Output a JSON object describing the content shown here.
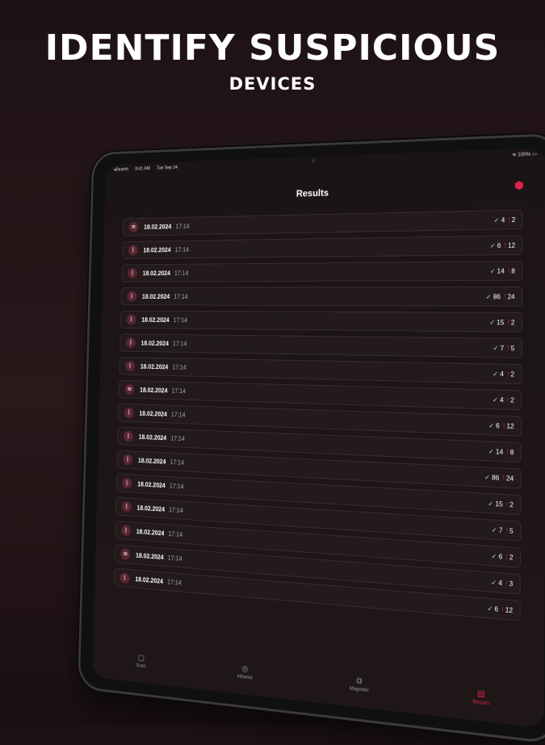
{
  "headline": "IDENTIFY SUSPICIOUS",
  "subheadline": "DEVICES",
  "status": {
    "back": "◂Search",
    "time": "9:41 AM",
    "date": "Tue Sep 24",
    "battery": "100%"
  },
  "screen_title": "Results",
  "accent": "#e0224a",
  "rows": [
    {
      "type": "wifi",
      "date": "18.02.2024",
      "time": "17:14",
      "ok": "4",
      "warn": "2"
    },
    {
      "type": "bluetooth",
      "date": "18.02.2024",
      "time": "17:14",
      "ok": "6",
      "warn": "12"
    },
    {
      "type": "bluetooth",
      "date": "18.02.2024",
      "time": "17:14",
      "ok": "14",
      "warn": "8"
    },
    {
      "type": "bluetooth",
      "date": "18.02.2024",
      "time": "17:14",
      "ok": "86",
      "warn": "24"
    },
    {
      "type": "bluetooth",
      "date": "18.02.2024",
      "time": "17:14",
      "ok": "15",
      "warn": "2"
    },
    {
      "type": "bluetooth",
      "date": "18.02.2024",
      "time": "17:14",
      "ok": "7",
      "warn": "5"
    },
    {
      "type": "bluetooth",
      "date": "18.02.2024",
      "time": "17:14",
      "ok": "4",
      "warn": "2"
    },
    {
      "type": "wifi",
      "date": "18.02.2024",
      "time": "17:14",
      "ok": "4",
      "warn": "2"
    },
    {
      "type": "bluetooth",
      "date": "18.02.2024",
      "time": "17:14",
      "ok": "6",
      "warn": "12"
    },
    {
      "type": "bluetooth",
      "date": "18.02.2024",
      "time": "17:14",
      "ok": "14",
      "warn": "8"
    },
    {
      "type": "bluetooth",
      "date": "18.02.2024",
      "time": "17:14",
      "ok": "86",
      "warn": "24"
    },
    {
      "type": "bluetooth",
      "date": "18.02.2024",
      "time": "17:14",
      "ok": "15",
      "warn": "2"
    },
    {
      "type": "bluetooth",
      "date": "18.02.2024",
      "time": "17:14",
      "ok": "7",
      "warn": "5"
    },
    {
      "type": "bluetooth",
      "date": "18.02.2024",
      "time": "17:14",
      "ok": "6",
      "warn": "2"
    },
    {
      "type": "wifi",
      "date": "18.02.2024",
      "time": "17:14",
      "ok": "4",
      "warn": "3"
    },
    {
      "type": "bluetooth",
      "date": "18.02.2024",
      "time": "17:14",
      "ok": "6",
      "warn": "12"
    }
  ],
  "tabs": [
    {
      "label": "Scan",
      "icon": "scan-icon",
      "active": false
    },
    {
      "label": "Infrared",
      "icon": "infrared-icon",
      "active": false
    },
    {
      "label": "Magnetic",
      "icon": "magnetic-icon",
      "active": false
    },
    {
      "label": "Results",
      "icon": "results-icon",
      "active": true
    }
  ]
}
